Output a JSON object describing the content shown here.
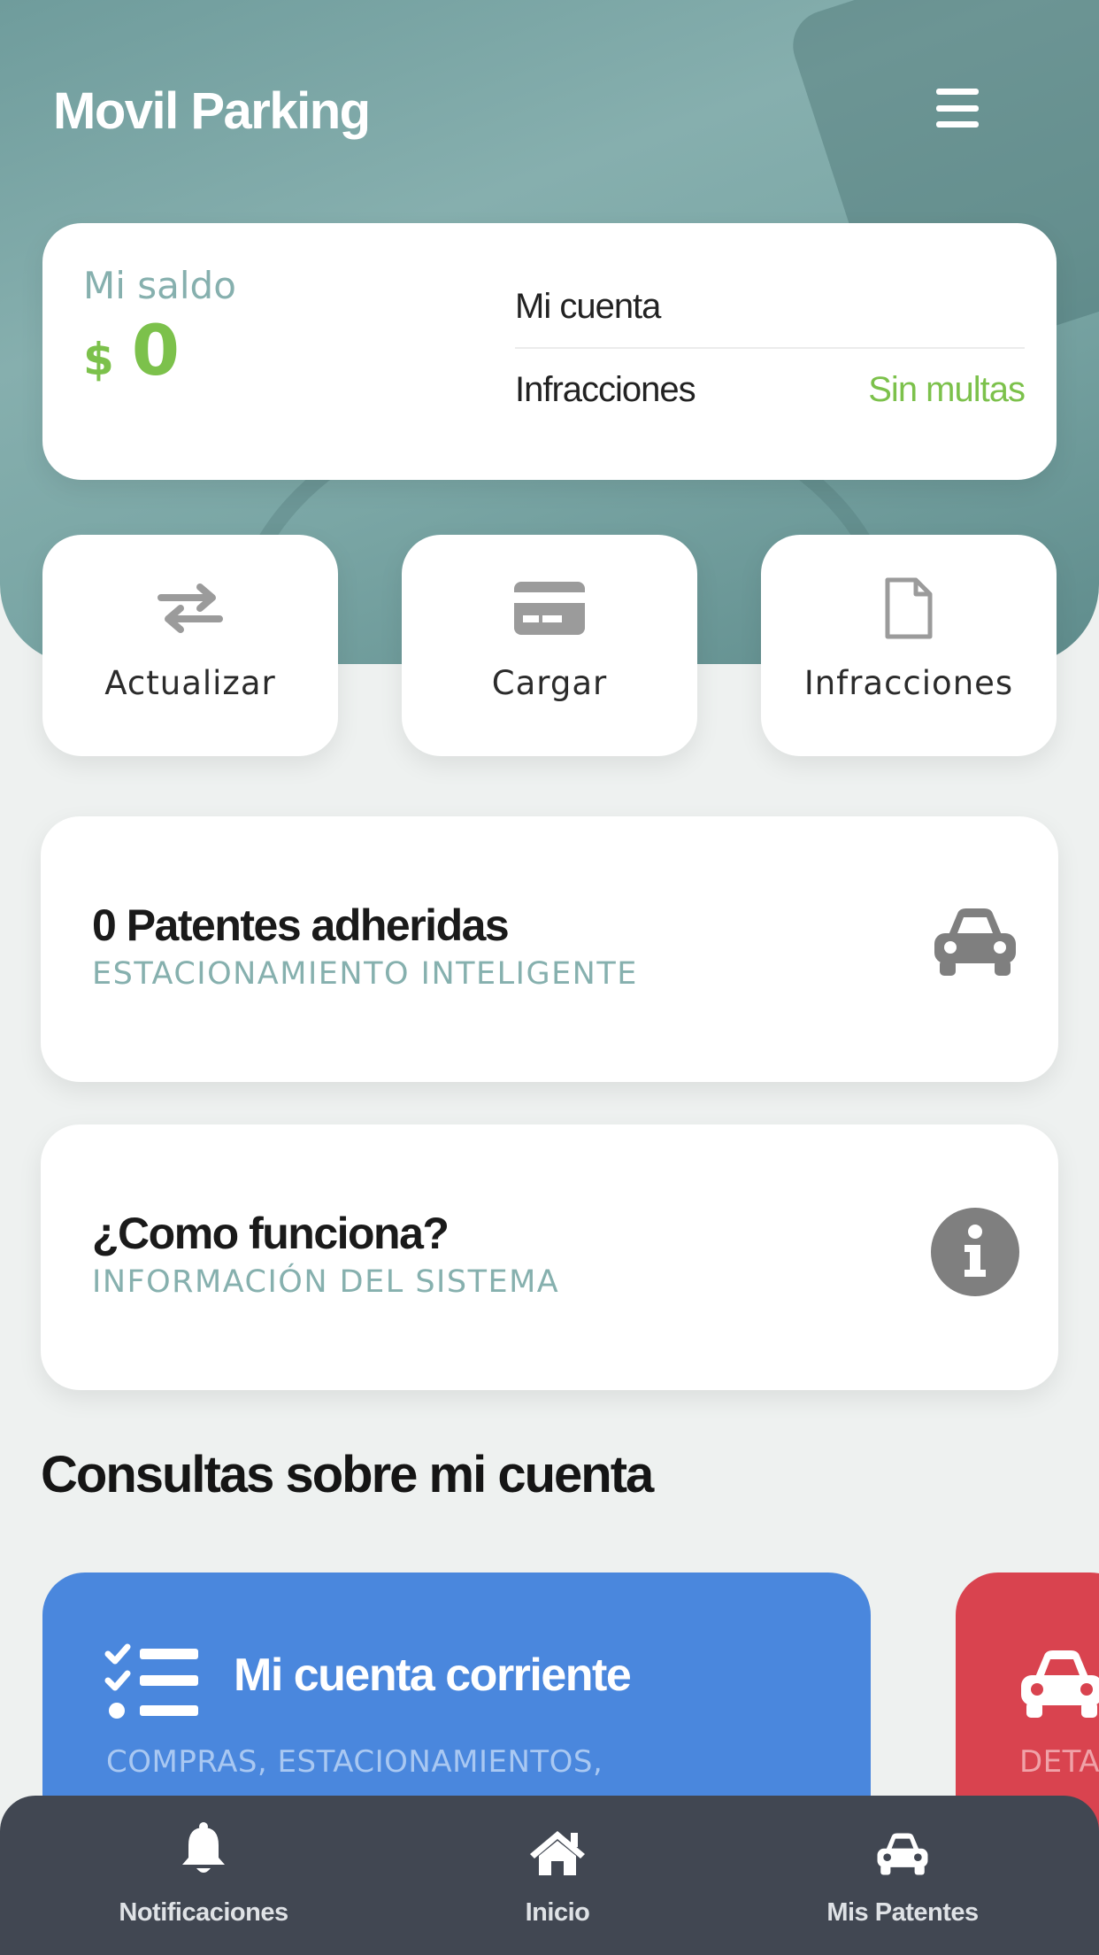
{
  "header": {
    "title": "Movil Parking",
    "menu_icon": "hamburger-menu-icon"
  },
  "balance": {
    "label": "Mi saldo",
    "currency": "$",
    "amount": "0",
    "account_label": "Mi cuenta",
    "infractions_label": "Infracciones",
    "infractions_status": "Sin multas"
  },
  "actions": [
    {
      "label": "Actualizar",
      "icon": "swap-arrows-icon"
    },
    {
      "label": "Cargar",
      "icon": "credit-card-icon"
    },
    {
      "label": "Infracciones",
      "icon": "document-icon"
    }
  ],
  "patentes": {
    "title": "0 Patentes adheridas",
    "subtitle": "ESTACIONAMIENTO INTELIGENTE",
    "icon": "car-icon"
  },
  "como": {
    "title": "¿Como funciona?",
    "subtitle": "INFORMACIÓN DEL SISTEMA",
    "icon": "info-circle-icon"
  },
  "section": {
    "title": "Consultas sobre mi cuenta"
  },
  "cards": [
    {
      "title": "Mi cuenta corriente",
      "subtitle": "COMPRAS, ESTACIONAMIENTOS,",
      "icon": "checklist-icon",
      "color": "#4a87dd"
    },
    {
      "subtitle": "DETA",
      "icon": "car-icon",
      "color": "#d9434f"
    }
  ],
  "nav": [
    {
      "label": "Notificaciones",
      "icon": "bell-icon"
    },
    {
      "label": "Inicio",
      "icon": "home-icon"
    },
    {
      "label": "Mis Patentes",
      "icon": "car-icon"
    }
  ],
  "colors": {
    "accent_green": "#7cc14b",
    "teal": "#86b0ae",
    "nav_bg": "#414752"
  }
}
